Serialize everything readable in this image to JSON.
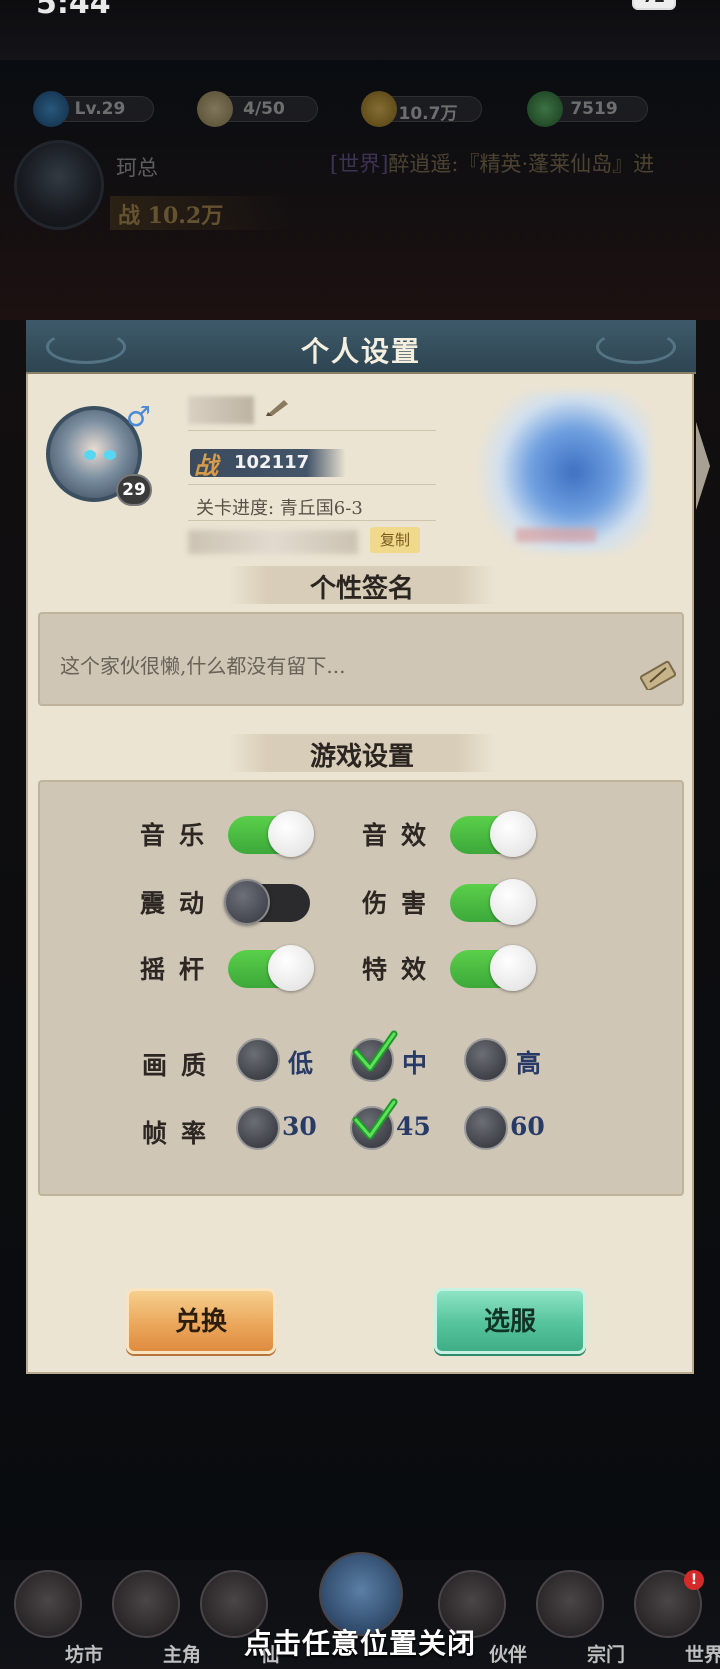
{
  "status_bar": {
    "time": "5:44",
    "battery": "72"
  },
  "top_hud": {
    "level": "Lv.29",
    "stamina": "4/50",
    "coins": "10.7万",
    "jade": "7519",
    "player_name": "珂总",
    "power": "战 10.2万",
    "world_chat_tag": "[世界]",
    "world_chat_text": "醉逍遥:『精英·蓬莱仙岛』进"
  },
  "modal": {
    "title": "个人设置",
    "profile": {
      "level": "29",
      "gender_symbol": "♂",
      "power_label": "战",
      "power_value": "102117",
      "stage_progress": "关卡进度: 青丘国6-3",
      "copy_label": "复制"
    },
    "signature": {
      "section_title": "个性签名",
      "text": "这个家伙很懒,什么都没有留下..."
    },
    "game_settings": {
      "section_title": "游戏设置",
      "toggles": [
        {
          "label": "音乐",
          "on": true
        },
        {
          "label": "音效",
          "on": true
        },
        {
          "label": "震动",
          "on": false
        },
        {
          "label": "伤害",
          "on": true
        },
        {
          "label": "摇杆",
          "on": true
        },
        {
          "label": "特效",
          "on": true
        }
      ],
      "quality": {
        "label": "画质",
        "options": [
          "低",
          "中",
          "高"
        ],
        "selected": "中"
      },
      "framerate": {
        "label": "帧率",
        "options": [
          "30",
          "45",
          "60"
        ],
        "selected": "45"
      }
    },
    "buttons": {
      "exchange": "兑换",
      "select_server": "选服"
    }
  },
  "bottom_nav": {
    "items": [
      "坊市",
      "主角",
      "仙",
      "",
      "伙伴",
      "宗门",
      "世界"
    ],
    "world_alert": "!"
  },
  "close_hint": "点击任意位置关闭",
  "colors": {
    "toggle_on": "#4cc044",
    "toggle_off": "#2b2a2d",
    "header": "#34505e",
    "panel": "#ece4d3",
    "radio_label": "#283a66"
  }
}
